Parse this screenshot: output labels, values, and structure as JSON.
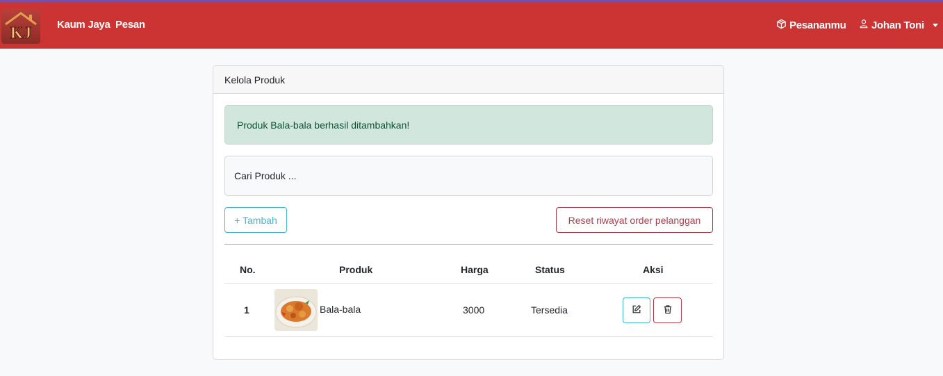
{
  "navbar": {
    "logo_text": "KJ",
    "brand": "Kaum Jaya",
    "links": {
      "order": "Pesan"
    },
    "orders_link": "Pesananmu",
    "user_name": "Johan Toni"
  },
  "card": {
    "title": "Kelola Produk",
    "alert": "Produk Bala-bala berhasil ditambahkan!",
    "search_placeholder": "Cari Produk ...",
    "add_button": "+ Tambah",
    "reset_button": "Reset riwayat order pelanggan"
  },
  "table": {
    "headers": {
      "no": "No.",
      "product": "Produk",
      "price": "Harga",
      "status": "Status",
      "action": "Aksi"
    },
    "rows": [
      {
        "no": "1",
        "product": "Bala-bala",
        "price": "3000",
        "status": "Tersedia"
      }
    ]
  },
  "colors": {
    "navbar_bg": "#cc3333",
    "alert_bg": "#d1e7dd",
    "info": "#3fb6cf",
    "danger": "#b03a48"
  },
  "icons": [
    "box-icon",
    "user-icon",
    "edit-icon",
    "trash-icon"
  ]
}
